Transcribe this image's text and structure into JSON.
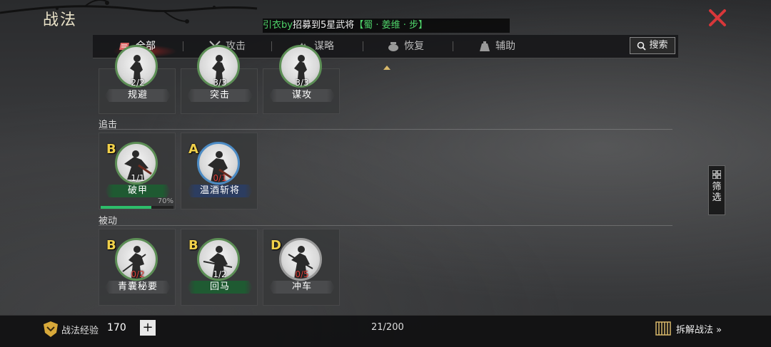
{
  "header": {
    "title": "战法"
  },
  "notice": {
    "player": "引衣by",
    "action": "招募到5星武将",
    "hero": "【蜀 · 姜维 · 步】"
  },
  "tabs": [
    {
      "label": "全部",
      "icon": "scroll-icon",
      "active": true
    },
    {
      "label": "攻击",
      "icon": "crossed-swords-icon",
      "active": false
    },
    {
      "label": "谋略",
      "icon": "hand-icon",
      "active": false
    },
    {
      "label": "恢复",
      "icon": "cauldron-icon",
      "active": false
    },
    {
      "label": "辅助",
      "icon": "bag-icon",
      "active": false
    }
  ],
  "search": {
    "label": "搜索"
  },
  "sections": {
    "top": {
      "cards": [
        {
          "count": "2/2",
          "name": "规避"
        },
        {
          "count": "3/3",
          "name": "突击"
        },
        {
          "count": "3/3",
          "name": "谋攻"
        }
      ]
    },
    "pursuit": {
      "label": "追击",
      "cards": [
        {
          "grade": "B",
          "count": "1/1",
          "name": "破甲",
          "progress_text": "70%",
          "progress": 0.7
        },
        {
          "grade": "A",
          "count": "0/1",
          "name": "温酒斩将"
        }
      ]
    },
    "passive": {
      "label": "被动",
      "cards": [
        {
          "grade": "B",
          "count": "0/2",
          "name": "青囊秘要"
        },
        {
          "grade": "B",
          "count": "1/2",
          "name": "回马"
        },
        {
          "grade": "D",
          "count": "0/5",
          "name": "冲车"
        }
      ]
    }
  },
  "filter": {
    "label_1": "筛",
    "label_2": "选"
  },
  "bottom": {
    "exp_label": "战法经验",
    "exp_value": "170",
    "plus_label": "+",
    "capacity": "21/200",
    "dismantle_label": "拆解战法 »"
  },
  "colors": {
    "accent_gold": "#f0d04a",
    "green_text": "#4fd46a",
    "red_count": "#e0403a",
    "close_red": "#d8373a"
  }
}
